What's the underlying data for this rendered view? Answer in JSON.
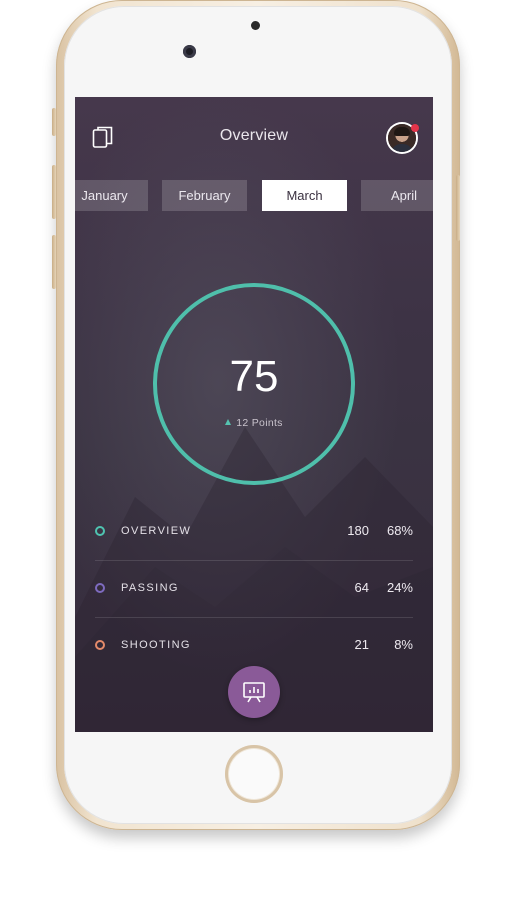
{
  "header": {
    "title": "Overview",
    "left_icon": "document-copy-icon",
    "right_icon": "avatar-photo"
  },
  "months": [
    "January",
    "February",
    "March",
    "April"
  ],
  "active_month": "March",
  "summary": {
    "score": "75",
    "points_label": "12 Points",
    "trend_icon": "up-triangle-icon",
    "ring_color": "#4fbfab"
  },
  "stats": [
    {
      "label": "OVERVIEW",
      "value": "180",
      "percent": "68%",
      "color": "#4fc4b1"
    },
    {
      "label": "PASSING",
      "value": "64",
      "percent": "24%",
      "color": "#7e6bbf"
    },
    {
      "label": "SHOOTING",
      "value": "21",
      "percent": "8%",
      "color": "#e48a6a"
    }
  ],
  "fab": {
    "icon": "presentation-chart-icon",
    "color": "#8a5a98"
  }
}
